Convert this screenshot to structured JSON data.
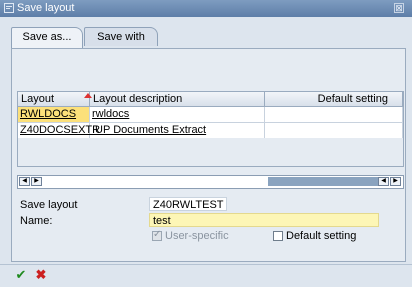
{
  "window": {
    "title": "Save layout"
  },
  "tabs": [
    {
      "label": "Save as..."
    },
    {
      "label": "Save with"
    }
  ],
  "grid": {
    "headers": {
      "layout": "Layout",
      "description": "Layout description",
      "default": "Default setting"
    },
    "rows": [
      {
        "layout": "RWLDOCS",
        "description": "rwldocs",
        "default": ""
      },
      {
        "layout": "Z40DOCSEXTR",
        "description": "IUP Documents Extract",
        "default": ""
      }
    ]
  },
  "form": {
    "save_layout_label": "Save layout",
    "save_layout_value": "Z40RWLTEST",
    "name_label": "Name:",
    "name_value": "test",
    "user_specific_label": "User-specific",
    "default_setting_label": "Default setting"
  },
  "colors": {
    "selected_cell": "#fce07a",
    "name_field_bg": "#fdf6b6",
    "title_bar": "#6a89b1"
  }
}
